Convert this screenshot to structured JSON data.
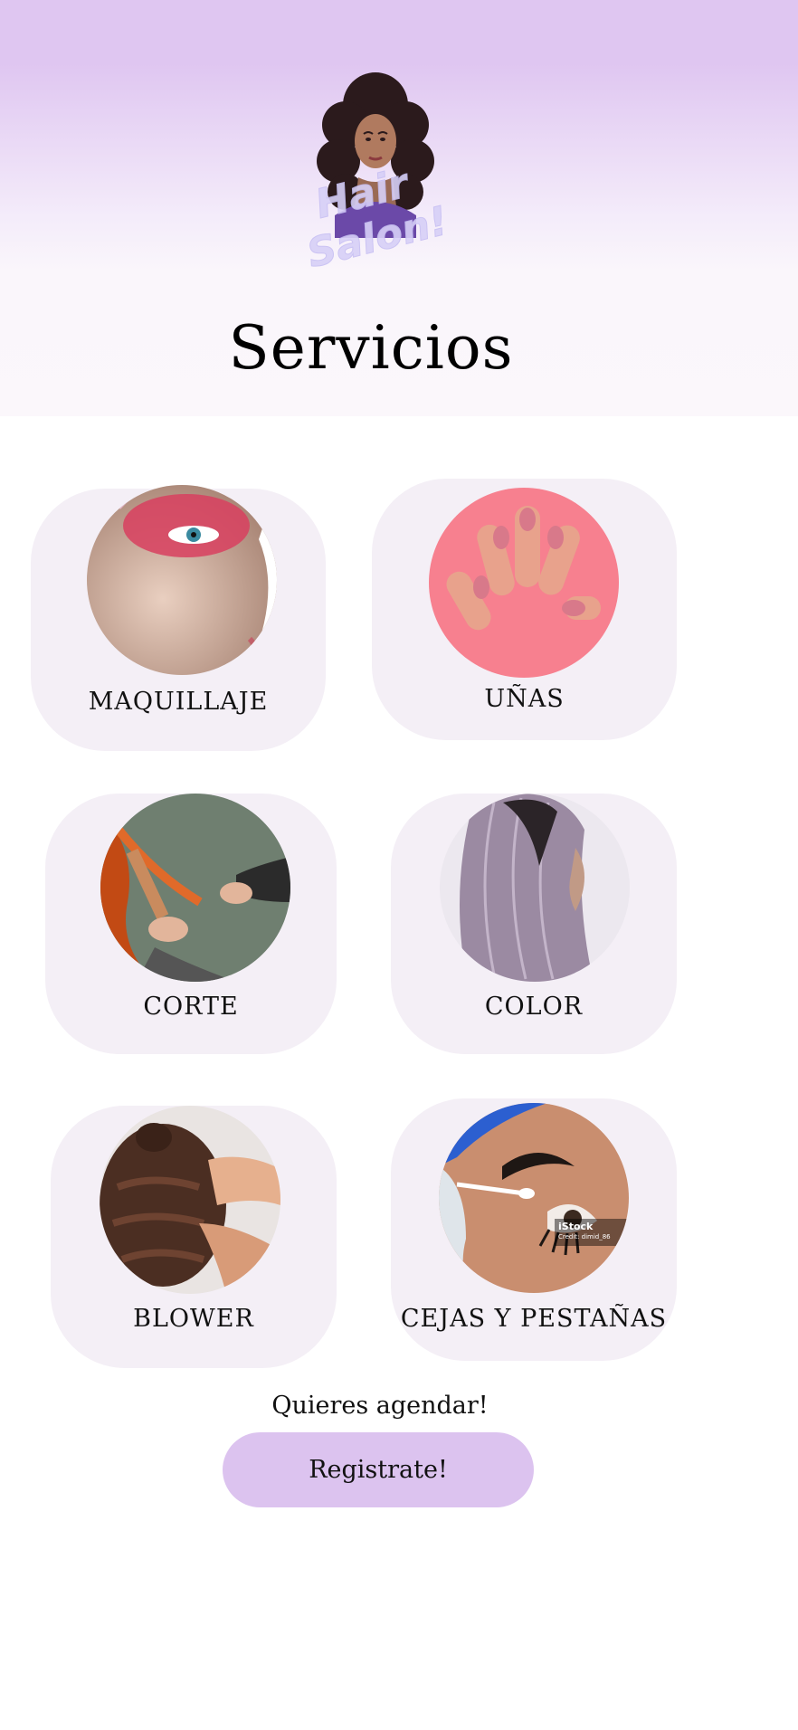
{
  "brand": {
    "logo_icon": "woman-curly-hair-icon",
    "logo_text_line1": "Hair",
    "logo_text_line2": "Salon!"
  },
  "page_title": "Servicios",
  "services": [
    {
      "label": "MAQUILLAJE",
      "image": "makeup-eye-photo"
    },
    {
      "label": "UÑAS",
      "image": "pink-nails-photo"
    },
    {
      "label": "CORTE",
      "image": "hair-cut-photo"
    },
    {
      "label": "COLOR",
      "image": "lavender-hair-photo"
    },
    {
      "label": "BLOWER",
      "image": "hair-styling-photo"
    },
    {
      "label": "CEJAS Y PESTAÑAS",
      "image": "eyebrow-lash-photo",
      "watermark": "iStock",
      "watermark_credit": "Credit: dimid_86"
    }
  ],
  "cta": {
    "question": "Quieres agendar!",
    "button_label": "Registrate!"
  },
  "colors": {
    "header_top": "#dfc6f1",
    "card_bg": "#f4eff6",
    "button_bg": "#dcc3ef"
  }
}
